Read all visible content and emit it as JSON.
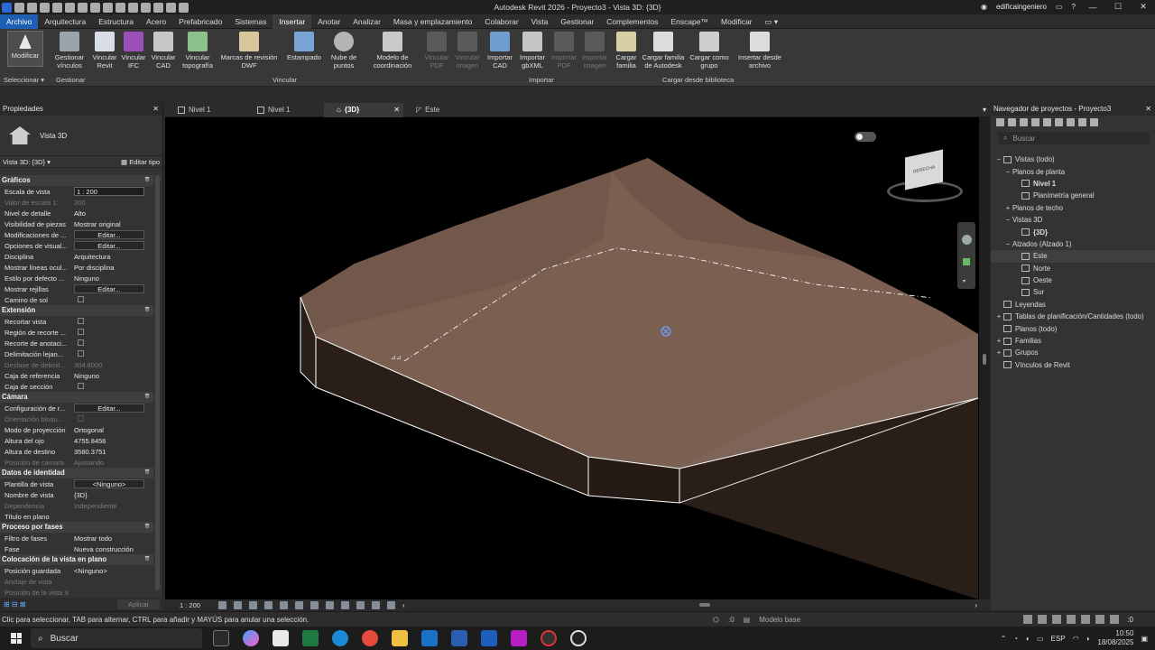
{
  "window": {
    "title": "Autodesk Revit 2026 - Proyecto3 - Vista 3D: {3D}",
    "user": "edificaingeniero"
  },
  "menu": [
    "Archivo",
    "Arquitectura",
    "Estructura",
    "Acero",
    "Prefabricado",
    "Sistemas",
    "Insertar",
    "Anotar",
    "Analizar",
    "Masa y emplazamiento",
    "Colaborar",
    "Vista",
    "Gestionar",
    "Complementos",
    "Enscape™",
    "Modificar"
  ],
  "menu_active": "Insertar",
  "ribbon": {
    "modify": "Modificar",
    "manage_links": "Gestionar vínculos",
    "link_revit": "Vincular Revit",
    "link_ifc": "Vincular IFC",
    "link_cad": "Vincular CAD",
    "link_topo": "Vincular topografía",
    "dwf": "Marcas de revisión DWF",
    "decal": "Estampado",
    "point_cloud": "Nube de puntos",
    "coord_model": "Modelo de coordinación",
    "link_pdf": "Vincular PDF",
    "link_image": "Vincular imagen",
    "import_cad": "Importar CAD",
    "import_gbxml": "Importar gbXML",
    "import_pdf": "Importar PDF",
    "import_image": "Importar imagen",
    "load_family": "Cargar familia",
    "load_autodesk": "Cargar familia de Autodesk",
    "load_group": "Cargar como grupo",
    "insert_file": "Insertar desde archivo",
    "panel_select": "Seleccionar",
    "panel_manage": "Gestionar",
    "panel_link": "Vincular",
    "panel_import": "Importar",
    "panel_library": "Cargar desde biblioteca"
  },
  "properties": {
    "header": "Propiedades",
    "type_name": "Vista 3D",
    "selector": "Vista 3D: {3D}",
    "edit_type": "Editar tipo",
    "apply": "Aplicar",
    "edit": "Editar...",
    "g_graficos": "Gráficos",
    "g_extension": "Extensión",
    "g_camara": "Cámara",
    "g_identidad": "Datos de identidad",
    "g_fases": "Proceso por fases",
    "g_plano": "Colocación de la vista en plano",
    "k_escala": "Escala de vista",
    "v_escala": "1 : 200",
    "k_valor": "Valor de escala   1:",
    "v_valor": "200",
    "k_detalle": "Nivel de detalle",
    "v_detalle": "Alto",
    "k_visib": "Visibilidad de piezas",
    "v_visib": "Mostrar original",
    "k_modif": "Modificaciones de ...",
    "k_opciones": "Opciones de visual...",
    "k_disciplina": "Disciplina",
    "v_disciplina": "Arquitectura",
    "k_lineas": "Mostrar líneas ocul...",
    "v_lineas": "Por disciplina",
    "k_estilo": "Estilo por defecto ...",
    "v_estilo": "Ninguno",
    "k_rejillas": "Mostrar rejillas",
    "k_camino": "Camino de sol",
    "k_recortar": "Recortar vista",
    "k_region": "Región de recorte ...",
    "k_recorte_anot": "Recorte de anotaci...",
    "k_delim": "Delimitación lejan...",
    "k_desfase": "Desfase de delimit...",
    "v_desfase": "304.8000",
    "k_cajaref": "Caja de referencia",
    "v_cajaref": "Ninguno",
    "k_cajasec": "Caja de sección",
    "k_config": "Configuración de r...",
    "k_orient": "Orientación bloqu...",
    "k_modoproy": "Modo de proyección",
    "v_modoproy": "Ortogonal",
    "k_ojo": "Altura del ojo",
    "v_ojo": "4755.8456",
    "k_destino": "Altura de destino",
    "v_destino": "3580.3751",
    "k_poscam": "Posición de cámara",
    "v_poscam": "Ajustando",
    "k_plantilla": "Plantilla de vista",
    "v_plantilla": "<Ninguno>",
    "k_nombre": "Nombre de vista",
    "v_nombre": "{3D}",
    "k_dependencia": "Dependencia",
    "v_dependencia": "Independiente",
    "k_titulo": "Título en plano",
    "k_filtro": "Filtro de fases",
    "v_filtro": "Mostrar todo",
    "k_fase": "Fase",
    "v_fase": "Nueva construcción",
    "k_posguard": "Posición guardada",
    "v_posguard": "<Ninguno>",
    "k_anclaje": "Anclaje de vista",
    "k_posx": "Posición de la vista X"
  },
  "tabs": [
    "Nivel 1",
    "Nivel 1",
    "{3D}",
    "Este"
  ],
  "viewport": {
    "scale": "1 : 200",
    "viewcube_label": "DERECHA",
    "terrain_top": "#7b5f51",
    "terrain_side": "#2a1e19"
  },
  "browser": {
    "header": "Navegador de proyectos - Proyecto3",
    "search_placeholder": "Buscar",
    "items": [
      {
        "label": "Vistas (todo)",
        "toggle": "−",
        "indent": 0,
        "icon": true
      },
      {
        "label": "Planos de planta",
        "toggle": "−",
        "indent": 1
      },
      {
        "label": "Nivel 1",
        "indent": 2,
        "icon": true,
        "bold": true
      },
      {
        "label": "Planimetría general",
        "indent": 2,
        "icon": true
      },
      {
        "label": "Planos de techo",
        "toggle": "+",
        "indent": 1
      },
      {
        "label": "Vistas 3D",
        "toggle": "−",
        "indent": 1
      },
      {
        "label": "{3D}",
        "indent": 2,
        "icon": true,
        "bold": true
      },
      {
        "label": "Alzados (Alzado 1)",
        "toggle": "−",
        "indent": 1
      },
      {
        "label": "Este",
        "indent": 2,
        "icon": true,
        "selected": true
      },
      {
        "label": "Norte",
        "indent": 2,
        "icon": true
      },
      {
        "label": "Oeste",
        "indent": 2,
        "icon": true
      },
      {
        "label": "Sur",
        "indent": 2,
        "icon": true
      },
      {
        "label": "Leyendas",
        "indent": 0,
        "icon": true
      },
      {
        "label": "Tablas de planificación/Cantidades (todo)",
        "toggle": "+",
        "indent": 0,
        "icon": true
      },
      {
        "label": "Planos (todo)",
        "indent": 0,
        "icon": true
      },
      {
        "label": "Familias",
        "toggle": "+",
        "indent": 0,
        "icon": true
      },
      {
        "label": "Grupos",
        "toggle": "+",
        "indent": 0,
        "icon": true
      },
      {
        "label": "Vínculos de Revit",
        "indent": 0,
        "icon": true
      }
    ]
  },
  "status": {
    "message": "Clic para seleccionar, TAB para alternar, CTRL para añadir y MAYÚS para anular una selección.",
    "zero": ":0",
    "model": "Modelo base",
    "filter": ":0"
  },
  "taskbar": {
    "search": "Buscar",
    "lang": "ESP",
    "time": "10:50",
    "date": "18/08/2025"
  }
}
